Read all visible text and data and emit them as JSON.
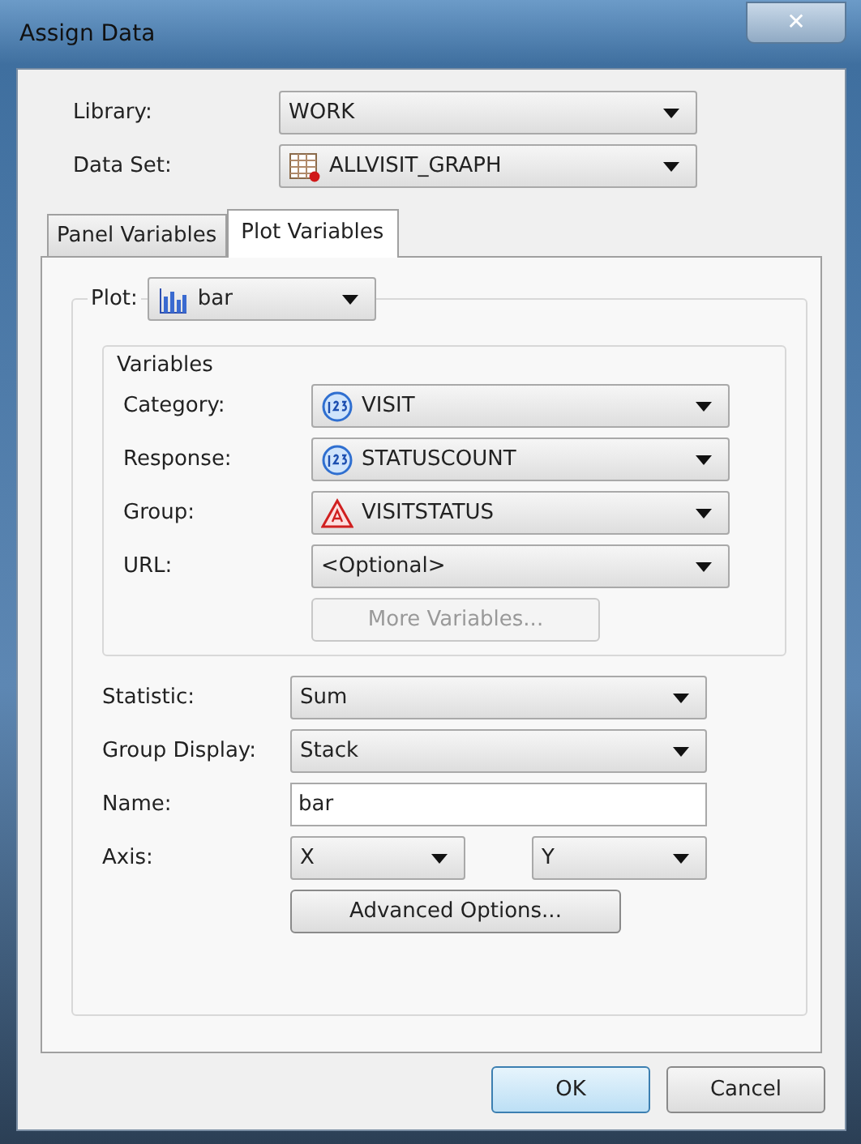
{
  "window": {
    "title": "Assign Data",
    "close": "✕"
  },
  "top_fields": [
    {
      "label": "Library:",
      "value": "WORK",
      "kind": "library"
    },
    {
      "label": "Data Set:",
      "value": "ALLVISIT_GRAPH",
      "kind": "dataset"
    }
  ],
  "tabs": [
    {
      "label": "Panel Variables",
      "selected": false
    },
    {
      "label": "Plot Variables",
      "selected": true
    }
  ],
  "plot": {
    "label": "Plot:",
    "value": "bar",
    "kind": "bar"
  },
  "variables": {
    "title": "Variables",
    "fields": [
      {
        "label": "Category:",
        "value": "VISIT",
        "kind": "numeric"
      },
      {
        "label": "Response:",
        "value": "STATUSCOUNT",
        "kind": "numeric"
      },
      {
        "label": "Group:",
        "value": "VISITSTATUS",
        "kind": "character"
      },
      {
        "label": "URL:",
        "value": "<Optional>",
        "kind": "link"
      }
    ],
    "more_button": {
      "label": "More Variables...",
      "disabled": true
    }
  },
  "options": [
    {
      "kind": "dropdown",
      "label": "Statistic:",
      "value": "Sum"
    },
    {
      "kind": "dropdown",
      "label": "Group Display:",
      "value": "Stack"
    },
    {
      "kind": "text",
      "label": "Name:",
      "value": "bar"
    },
    {
      "kind": "axis",
      "label": "Axis:",
      "values": [
        "X",
        "Y"
      ]
    }
  ],
  "advanced_button": {
    "label": "Advanced Options...",
    "disabled": false
  },
  "buttons": [
    {
      "label": "OK",
      "default": true
    },
    {
      "label": "Cancel",
      "default": false
    }
  ]
}
